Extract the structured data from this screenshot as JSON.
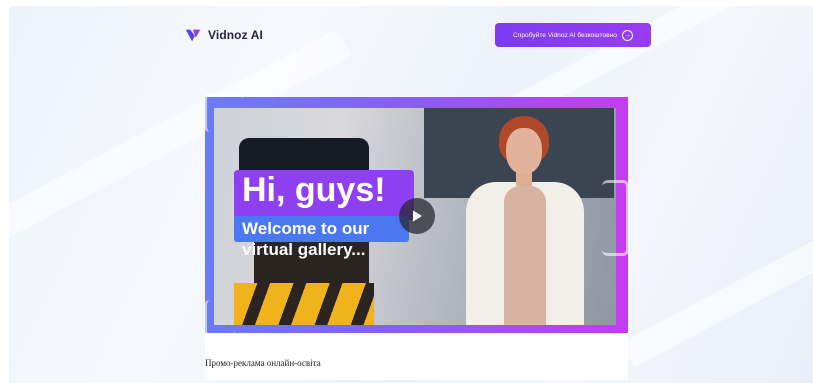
{
  "header": {
    "logo_text": "Vidnoz AI",
    "logo_icon": "vidnoz-logo-icon",
    "cta_label": "Спробуйте Vidnoz AI безкоштовно",
    "cta_icon": "arrow-right-circle-icon"
  },
  "video": {
    "headline": "Hi, guys!",
    "line1": "Welcome to our",
    "line2": "virtual gallery...",
    "play_icon": "play-icon"
  },
  "caption": "Промо-реклама онлайн-освіта",
  "colors": {
    "accent": "#8a3cf4",
    "frame_start": "#6a7cf6",
    "frame_end": "#c53cf0",
    "headline_bg": "#8f3ff2",
    "subline_bg": "#4a78f2"
  }
}
